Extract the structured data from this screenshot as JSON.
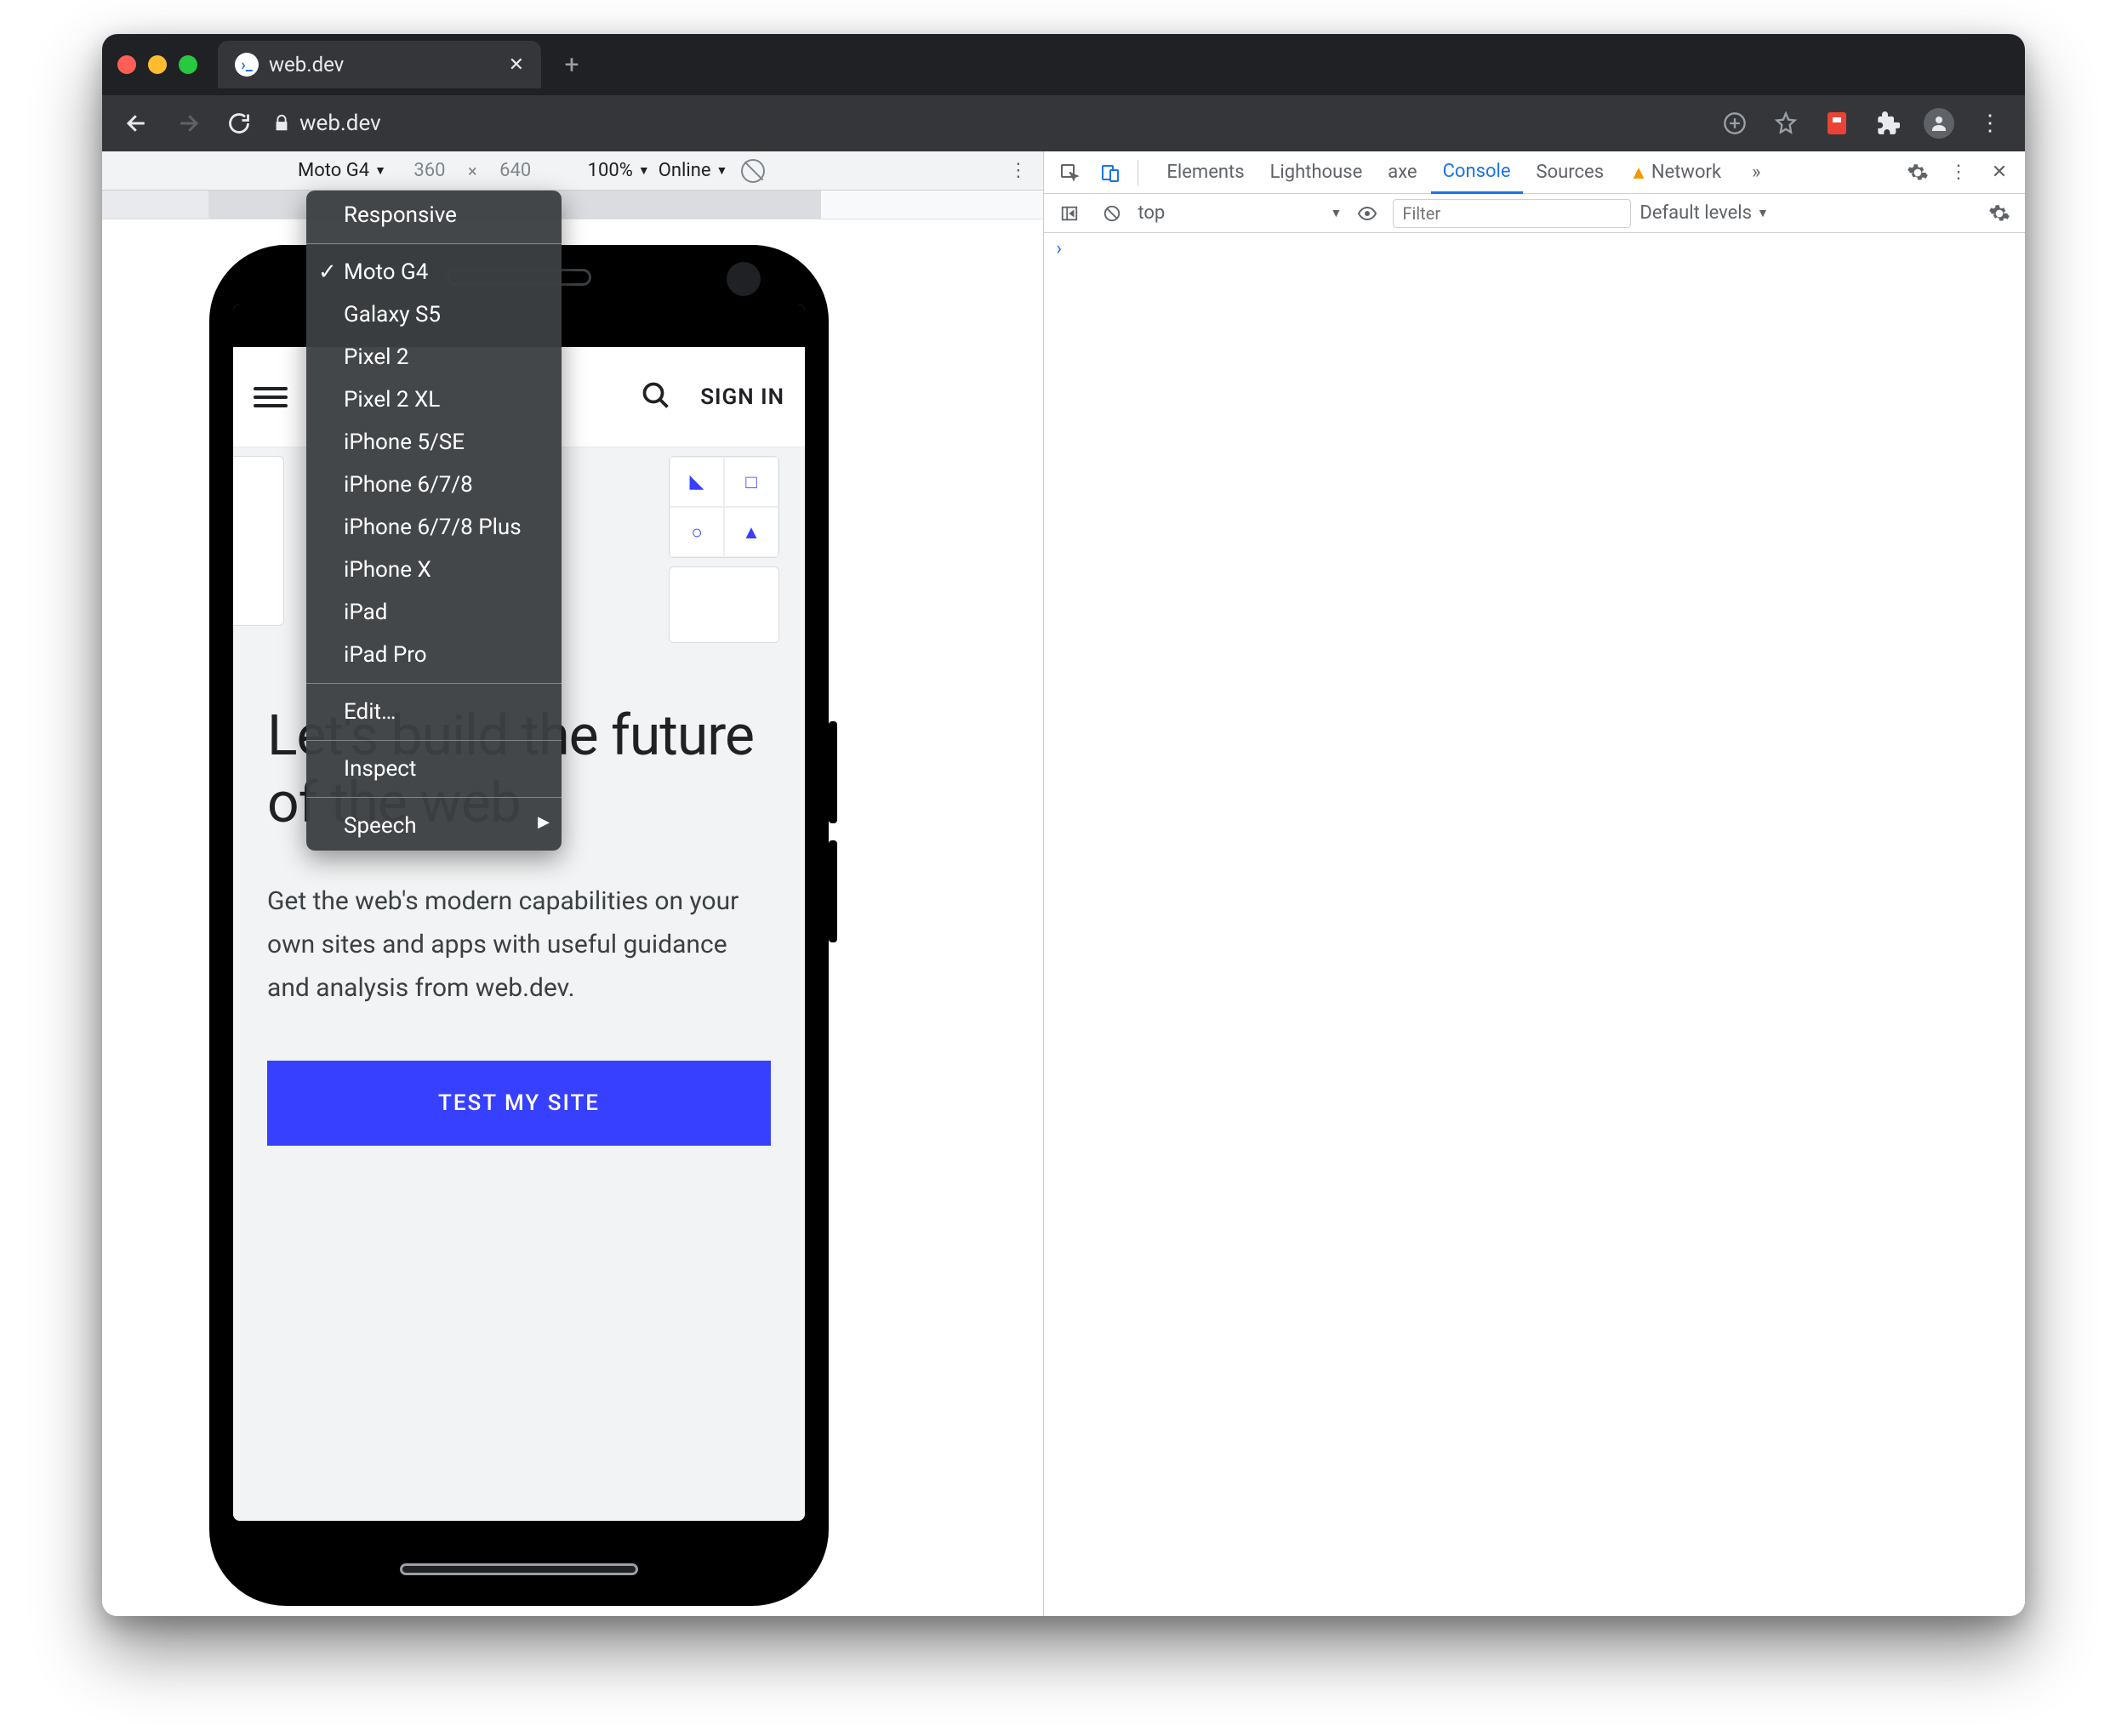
{
  "window": {
    "tab_title": "web.dev"
  },
  "toolbar": {
    "url": "web.dev"
  },
  "device_bar": {
    "device": "Moto G4",
    "width": "360",
    "height": "640",
    "zoom": "100%",
    "throttle": "Online"
  },
  "device_menu": {
    "responsive": "Responsive",
    "devices": [
      "Moto G4",
      "Galaxy S5",
      "Pixel 2",
      "Pixel 2 XL",
      "iPhone 5/SE",
      "iPhone 6/7/8",
      "iPhone 6/7/8 Plus",
      "iPhone X",
      "iPad",
      "iPad Pro"
    ],
    "selected_index": 0,
    "edit": "Edit…",
    "inspect": "Inspect",
    "speech": "Speech"
  },
  "site": {
    "sign_in": "SIGN IN",
    "heading": "Let's build the future of the web",
    "subheading": "Get the web's modern capabilities on your own sites and apps with useful guidance and analysis from web.dev.",
    "cta": "TEST MY SITE",
    "tile_icons": [
      "◣",
      "□",
      "○",
      "▲"
    ]
  },
  "devtools": {
    "tabs": [
      "Elements",
      "Lighthouse",
      "axe",
      "Console",
      "Sources",
      "Network"
    ],
    "active_tab_index": 3,
    "more": "»",
    "context": "top",
    "filter_placeholder": "Filter",
    "levels": "Default levels",
    "prompt": "›"
  }
}
